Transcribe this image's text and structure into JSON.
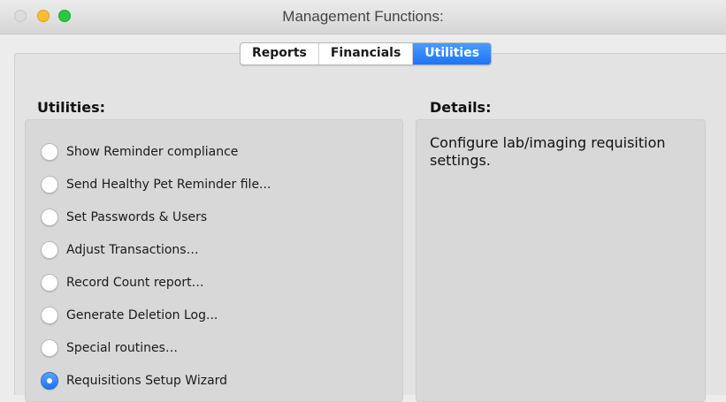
{
  "window": {
    "title": "Management Functions:",
    "buttons": [
      "close",
      "minimize",
      "maximize"
    ]
  },
  "tabs": [
    {
      "label": "Reports",
      "active": false
    },
    {
      "label": "Financials",
      "active": false
    },
    {
      "label": "Utilities",
      "active": true
    }
  ],
  "utilities": {
    "heading": "Utilities:",
    "options": [
      {
        "label": "Show Reminder compliance",
        "selected": false
      },
      {
        "label": "Send Healthy Pet Reminder file...",
        "selected": false
      },
      {
        "label": "Set Passwords & Users",
        "selected": false
      },
      {
        "label": "Adjust Transactions…",
        "selected": false
      },
      {
        "label": "Record Count report…",
        "selected": false
      },
      {
        "label": "Generate Deletion Log...",
        "selected": false
      },
      {
        "label": "Special routines…",
        "selected": false
      },
      {
        "label": "Requisitions Setup Wizard",
        "selected": true
      }
    ]
  },
  "details": {
    "heading": "Details:",
    "text": "Configure lab/imaging requisition settings."
  },
  "colors": {
    "accent": "#1d74f5",
    "window_bg": "#ececec",
    "panel_bg": "#d8d8d8"
  }
}
